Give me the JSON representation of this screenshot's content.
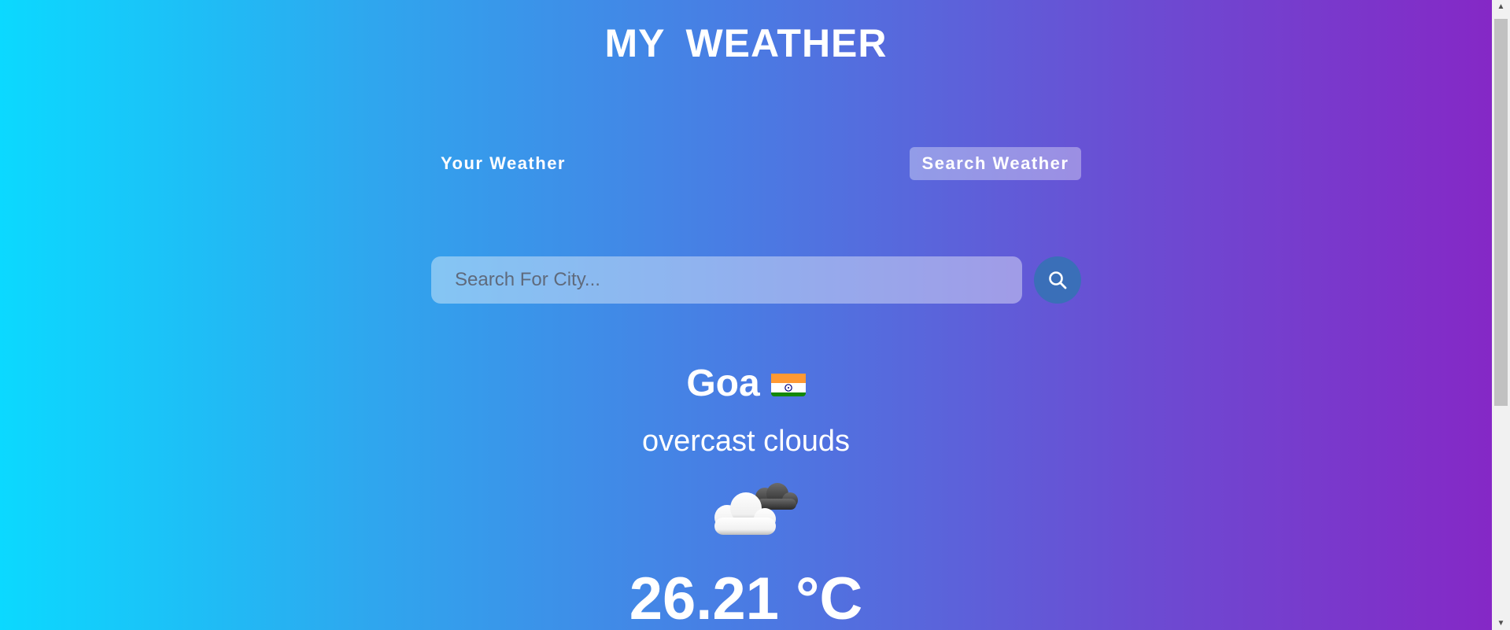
{
  "header": {
    "title": "MY  WEATHER"
  },
  "tabs": [
    {
      "label": "Your Weather",
      "active": false
    },
    {
      "label": "Search Weather",
      "active": true
    }
  ],
  "search": {
    "placeholder": "Search For City...",
    "value": "",
    "button_icon": "search-icon"
  },
  "weather": {
    "city": "Goa",
    "country_flag": "india-flag-icon",
    "description": "overcast clouds",
    "icon": "overcast-clouds-icon",
    "temperature": "26.21 °C"
  },
  "colors": {
    "gradient_start": "#0bd9ff",
    "gradient_end": "#8528c6",
    "search_button": "#3a6fb8"
  }
}
